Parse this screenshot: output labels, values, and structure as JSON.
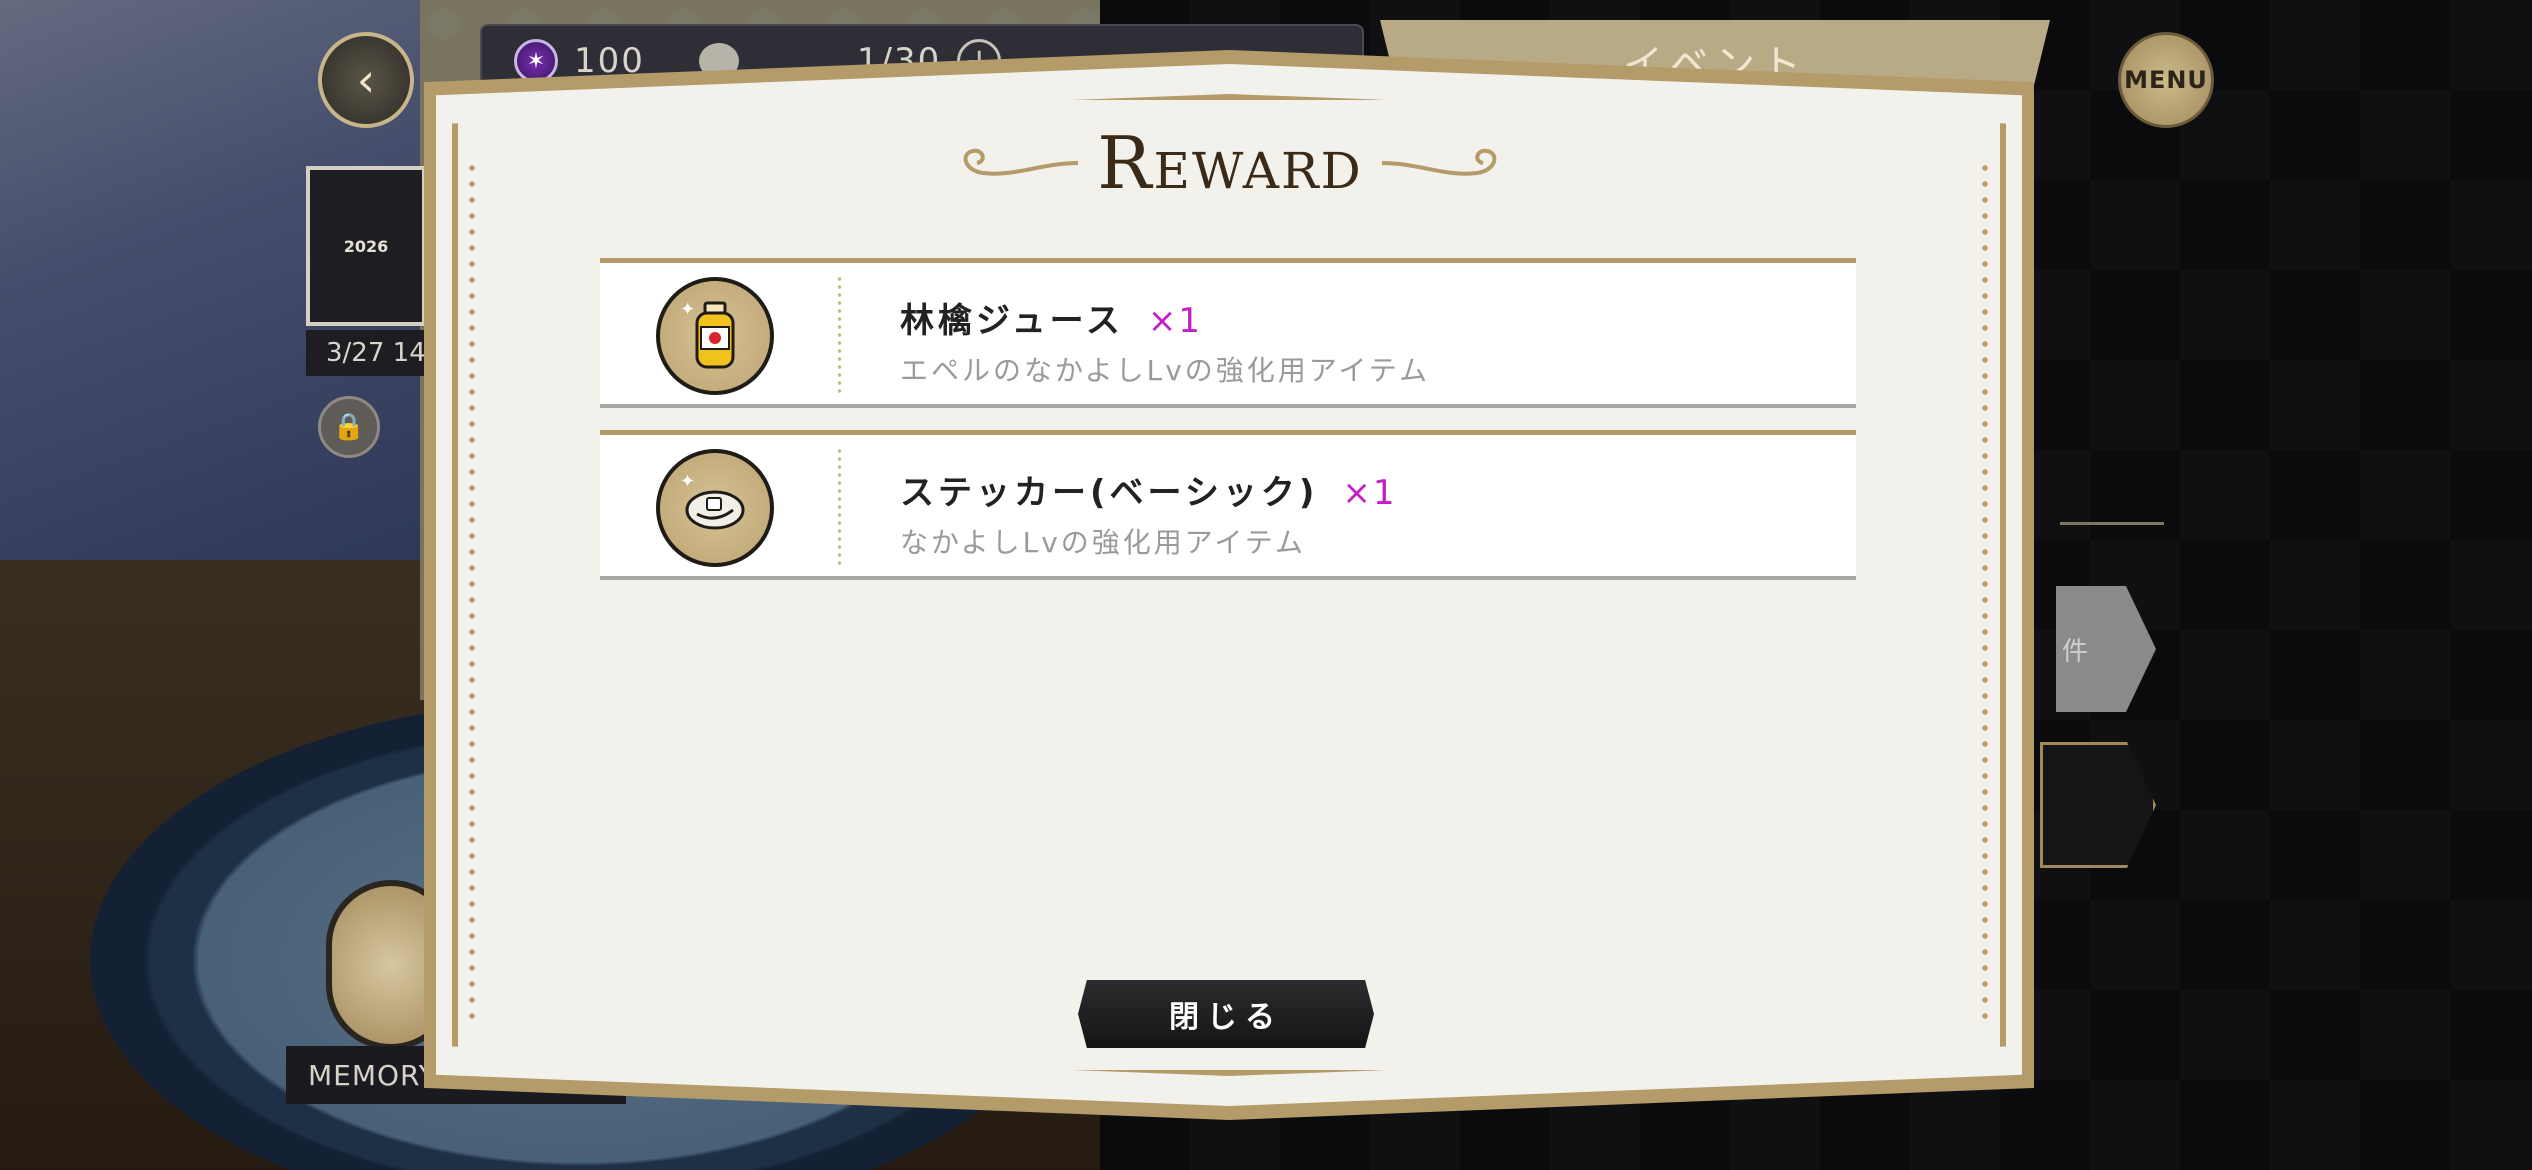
{
  "hud": {
    "gems": "100",
    "stamina": "1/30",
    "plus": "+",
    "event_tab": "イベント",
    "menu": "MENU",
    "back": "‹"
  },
  "background": {
    "card_year": "2026",
    "date": "3/27 14",
    "memory_label": "MEMORY PIECE",
    "right_button": "件"
  },
  "modal": {
    "title": "Reward",
    "items": [
      {
        "name": "林檎ジュース",
        "qty": "×1",
        "desc": "エペルのなかよしLvの強化用アイテム",
        "icon": "apple-juice-bottle-icon"
      },
      {
        "name": "ステッカー(ベーシック)",
        "qty": "×1",
        "desc": "なかよしLvの強化用アイテム",
        "icon": "sticker-icon"
      }
    ],
    "close_label": "閉じる"
  },
  "colors": {
    "gold": "#b49b6a",
    "qty_magenta": "#c21fc6",
    "modal_bg": "#f3f1ec"
  }
}
